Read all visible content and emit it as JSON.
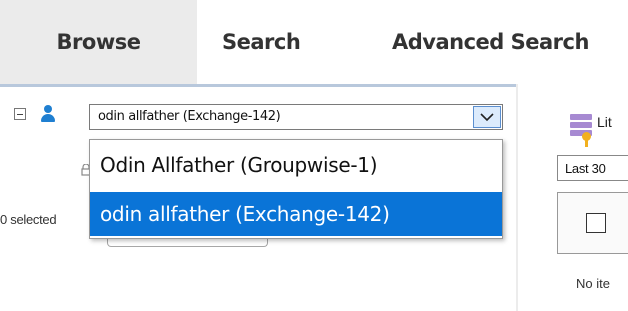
{
  "tabs": {
    "browse": "Browse",
    "search": "Search",
    "advanced_search": "Advanced Search"
  },
  "tree": {
    "collapse_icon": "minus-square-icon",
    "user_icon": "user-icon"
  },
  "mailbox_combo": {
    "value": "odin allfather (Exchange-142)",
    "options": [
      "Odin Allfather (Groupwise-1)",
      "odin allfather (Exchange-142)"
    ],
    "selected_option": "odin allfather (Exchange-142)"
  },
  "left_panel": {
    "selected_text": "0 selected"
  },
  "right_panel": {
    "list_label": "Lit",
    "date_range": "Last 30",
    "no_items": "No ite"
  },
  "colors": {
    "highlight": "#0a74d7",
    "active_tab": "#ebebeb",
    "user_icon": "#1f7fd1"
  }
}
